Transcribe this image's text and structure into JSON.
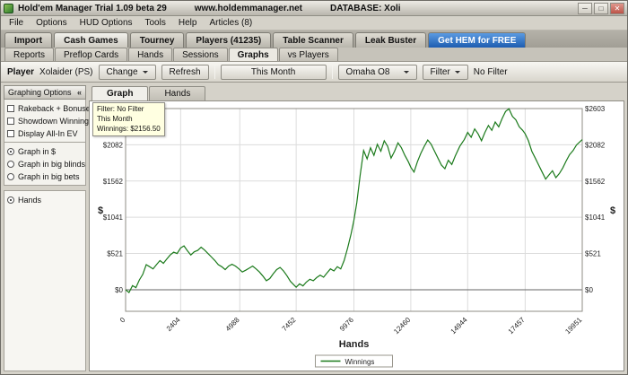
{
  "window": {
    "title": "Hold'em Manager Trial 1.09 beta 29",
    "site": "www.holdemmanager.net",
    "database": "DATABASE: Xoli",
    "controls": {
      "minimize": "─",
      "maximize": "□",
      "close": "✕"
    }
  },
  "menu": {
    "items": [
      "File",
      "Options",
      "HUD Options",
      "Tools",
      "Help",
      "Articles (8)"
    ]
  },
  "main_tabs": {
    "items": [
      "Import",
      "Cash Games",
      "Tourney",
      "Players (41235)",
      "Table Scanner",
      "Leak Buster"
    ],
    "active": "Cash Games",
    "promo": "Get HEM for FREE"
  },
  "sub_tabs": {
    "items": [
      "Reports",
      "Preflop Cards",
      "Hands",
      "Sessions",
      "Graphs",
      "vs Players"
    ],
    "active": "Graphs"
  },
  "toolbar": {
    "player_label": "Player",
    "player_name": "Xolaider (PS)",
    "change_label": "Change",
    "refresh_label": "Refresh",
    "month_label": "This Month",
    "game_label": "Omaha O8",
    "filter_label": "Filter",
    "no_filter_label": "No Filter"
  },
  "sidebar": {
    "header": "Graphing Options",
    "collapse_icon": "«",
    "checkboxes": [
      {
        "label": "Rakeback + Bonuses",
        "checked": false
      },
      {
        "label": "Showdown Winnings",
        "checked": false
      },
      {
        "label": "Display All-In EV",
        "checked": false
      }
    ],
    "radios": [
      {
        "label": "Graph in $",
        "checked": true
      },
      {
        "label": "Graph in big blinds",
        "checked": false
      },
      {
        "label": "Graph in big bets",
        "checked": false
      }
    ],
    "list": {
      "items": [
        {
          "label": "Hands",
          "selected": true
        }
      ]
    }
  },
  "chart_tabs": {
    "items": [
      "Graph",
      "Hands"
    ],
    "active": "Graph"
  },
  "tooltip": {
    "lines": [
      "Filter: No Filter",
      "This Month",
      "Winnings: $2156.50"
    ]
  },
  "chart_data": {
    "type": "line",
    "title": "",
    "xlabel": "Hands",
    "ylabel": "$",
    "xlim": [
      0,
      19951
    ],
    "ylim": [
      -310,
      2603
    ],
    "x_ticks": [
      0,
      2404,
      4988,
      7452,
      9976,
      12460,
      14944,
      17457,
      19951
    ],
    "y_tick_values": [
      0,
      521,
      1041,
      1562,
      2082,
      2603
    ],
    "y_tick_prefix": "$",
    "grid": true,
    "legend_position": "bottom-center",
    "legend": [
      {
        "name": "Winnings"
      }
    ],
    "series": [
      {
        "name": "Winnings",
        "color": "#1b7a1b",
        "points": [
          [
            0,
            0
          ],
          [
            150,
            -40
          ],
          [
            300,
            60
          ],
          [
            450,
            30
          ],
          [
            600,
            140
          ],
          [
            750,
            220
          ],
          [
            900,
            360
          ],
          [
            1050,
            330
          ],
          [
            1200,
            300
          ],
          [
            1350,
            360
          ],
          [
            1500,
            420
          ],
          [
            1650,
            380
          ],
          [
            1800,
            440
          ],
          [
            1950,
            500
          ],
          [
            2100,
            540
          ],
          [
            2250,
            520
          ],
          [
            2404,
            600
          ],
          [
            2550,
            630
          ],
          [
            2700,
            560
          ],
          [
            2850,
            500
          ],
          [
            3000,
            545
          ],
          [
            3150,
            565
          ],
          [
            3300,
            610
          ],
          [
            3450,
            570
          ],
          [
            3600,
            520
          ],
          [
            3750,
            470
          ],
          [
            3900,
            420
          ],
          [
            4050,
            360
          ],
          [
            4200,
            330
          ],
          [
            4350,
            290
          ],
          [
            4500,
            340
          ],
          [
            4650,
            365
          ],
          [
            4800,
            340
          ],
          [
            4950,
            300
          ],
          [
            5100,
            255
          ],
          [
            5250,
            280
          ],
          [
            5400,
            310
          ],
          [
            5550,
            340
          ],
          [
            5700,
            300
          ],
          [
            5850,
            255
          ],
          [
            6000,
            195
          ],
          [
            6150,
            130
          ],
          [
            6300,
            160
          ],
          [
            6450,
            230
          ],
          [
            6600,
            290
          ],
          [
            6750,
            320
          ],
          [
            6900,
            270
          ],
          [
            7050,
            200
          ],
          [
            7200,
            120
          ],
          [
            7452,
            35
          ],
          [
            7600,
            85
          ],
          [
            7750,
            55
          ],
          [
            7900,
            110
          ],
          [
            8050,
            150
          ],
          [
            8200,
            130
          ],
          [
            8350,
            175
          ],
          [
            8500,
            210
          ],
          [
            8650,
            180
          ],
          [
            8800,
            240
          ],
          [
            8950,
            300
          ],
          [
            9100,
            270
          ],
          [
            9250,
            330
          ],
          [
            9400,
            300
          ],
          [
            9550,
            420
          ],
          [
            9700,
            600
          ],
          [
            9850,
            800
          ],
          [
            9976,
            1000
          ],
          [
            10100,
            1250
          ],
          [
            10250,
            1650
          ],
          [
            10400,
            2000
          ],
          [
            10550,
            1880
          ],
          [
            10700,
            2040
          ],
          [
            10850,
            1930
          ],
          [
            11000,
            2090
          ],
          [
            11150,
            1990
          ],
          [
            11300,
            2140
          ],
          [
            11450,
            2060
          ],
          [
            11600,
            1890
          ],
          [
            11750,
            1990
          ],
          [
            11900,
            2110
          ],
          [
            12050,
            2040
          ],
          [
            12200,
            1930
          ],
          [
            12350,
            1840
          ],
          [
            12460,
            1760
          ],
          [
            12600,
            1690
          ],
          [
            12750,
            1840
          ],
          [
            12900,
            1960
          ],
          [
            13050,
            2060
          ],
          [
            13200,
            2150
          ],
          [
            13350,
            2090
          ],
          [
            13500,
            1990
          ],
          [
            13650,
            1890
          ],
          [
            13800,
            1790
          ],
          [
            13950,
            1740
          ],
          [
            14100,
            1860
          ],
          [
            14250,
            1800
          ],
          [
            14400,
            1920
          ],
          [
            14600,
            2060
          ],
          [
            14800,
            2160
          ],
          [
            14944,
            2260
          ],
          [
            15100,
            2190
          ],
          [
            15250,
            2310
          ],
          [
            15400,
            2240
          ],
          [
            15550,
            2140
          ],
          [
            15700,
            2260
          ],
          [
            15850,
            2360
          ],
          [
            16000,
            2290
          ],
          [
            16150,
            2410
          ],
          [
            16300,
            2340
          ],
          [
            16450,
            2460
          ],
          [
            16600,
            2560
          ],
          [
            16750,
            2600
          ],
          [
            16900,
            2490
          ],
          [
            17050,
            2440
          ],
          [
            17200,
            2340
          ],
          [
            17350,
            2290
          ],
          [
            17457,
            2240
          ],
          [
            17600,
            2140
          ],
          [
            17750,
            1990
          ],
          [
            17900,
            1890
          ],
          [
            18050,
            1790
          ],
          [
            18200,
            1690
          ],
          [
            18350,
            1590
          ],
          [
            18500,
            1650
          ],
          [
            18650,
            1710
          ],
          [
            18800,
            1610
          ],
          [
            18950,
            1670
          ],
          [
            19100,
            1750
          ],
          [
            19250,
            1850
          ],
          [
            19400,
            1940
          ],
          [
            19550,
            2000
          ],
          [
            19700,
            2080
          ],
          [
            19951,
            2156.5
          ]
        ]
      }
    ]
  }
}
